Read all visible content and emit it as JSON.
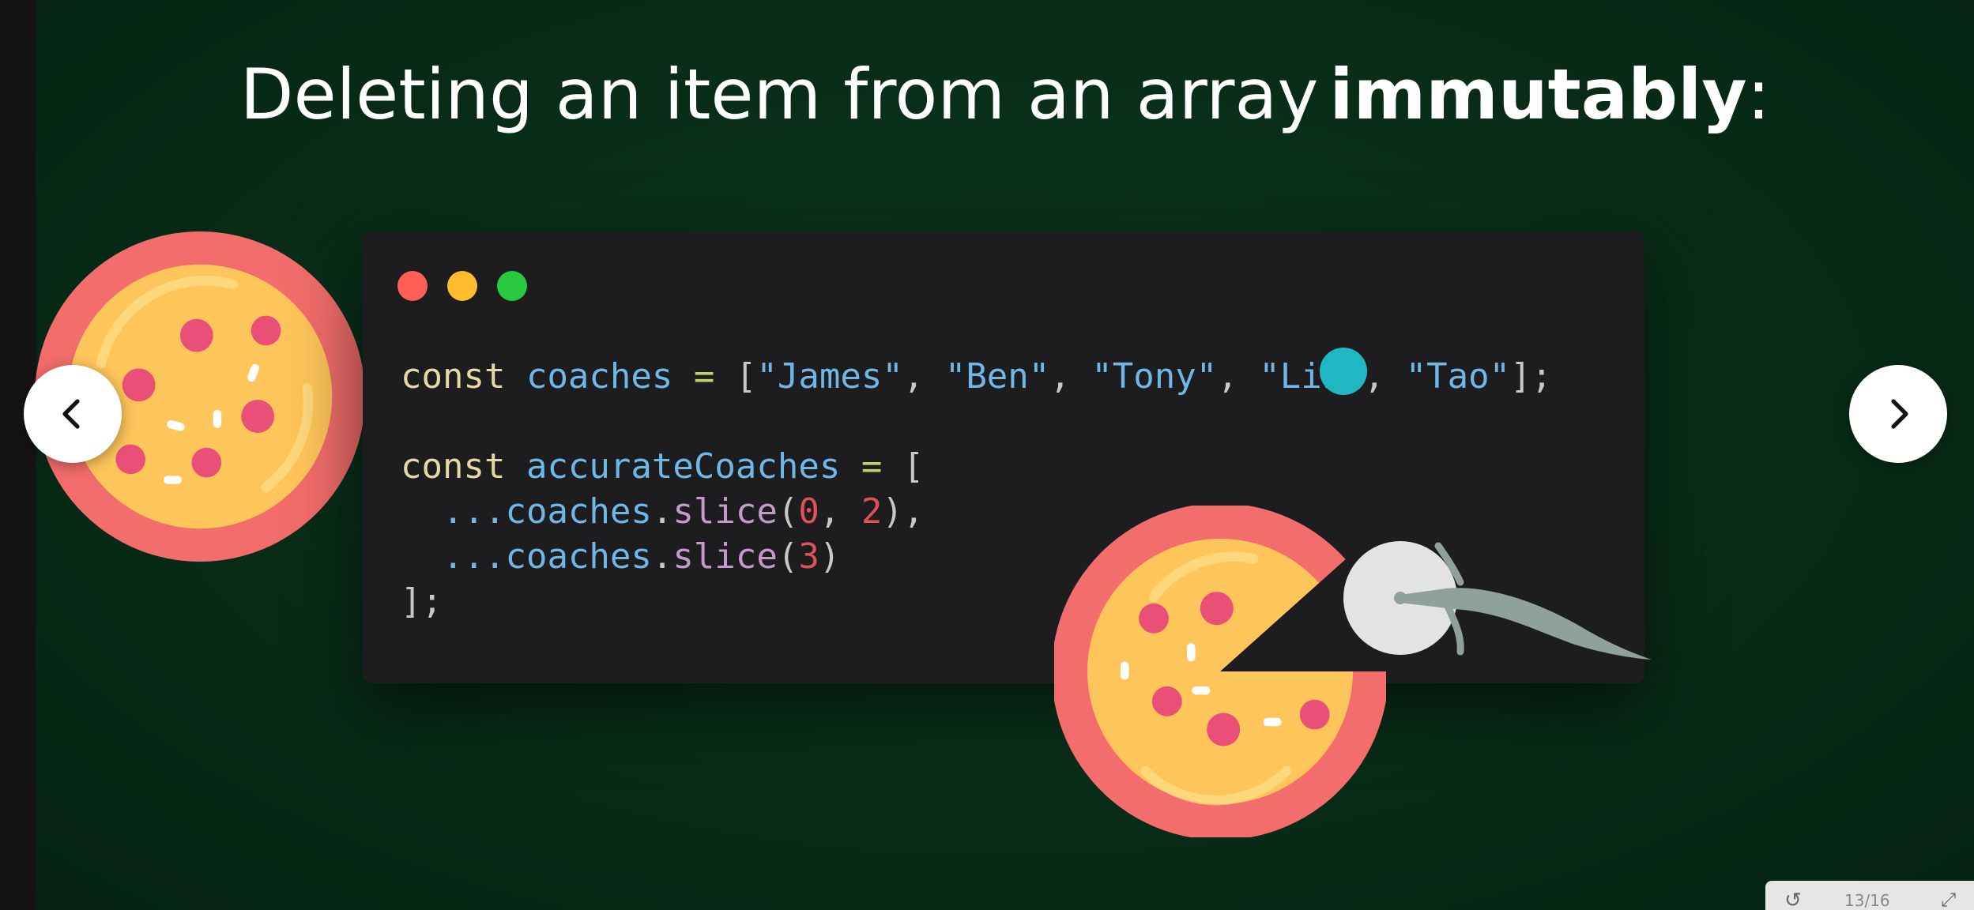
{
  "slide": {
    "title_normal": "Deleting  an item from an array",
    "title_bold": "immutably",
    "title_suffix": ":"
  },
  "code": {
    "line1": {
      "kw": "const",
      "name": "coaches",
      "op": "=",
      "open": "[",
      "s1": "\"James\"",
      "c1": ",",
      "s2": "\"Ben\"",
      "c2": ",",
      "s3": "\"Tony\"",
      "c3": ",",
      "s4": "\"Liz\"",
      "c4": ",",
      "s5": "\"Tao\"",
      "close": "];"
    },
    "line3": {
      "kw": "const",
      "name": "accurateCoaches",
      "op": "=",
      "open": "["
    },
    "line4": {
      "spread": "...",
      "obj": "coaches",
      "dot": ".",
      "fn": "slice",
      "po": "(",
      "a": "0",
      "comma": ",",
      "b": "2",
      "pc": "),"
    },
    "line5": {
      "spread": "...",
      "obj": "coaches",
      "dot": ".",
      "fn": "slice",
      "po": "(",
      "a": "3",
      "pc": ")"
    },
    "line6": {
      "close": "];"
    }
  },
  "nav": {
    "prev_icon": "chevron-left-icon",
    "next_icon": "chevron-right-icon"
  },
  "colors": {
    "background": "#042212",
    "code_bg": "#1d1d20",
    "traffic_red": "#ff5f57",
    "traffic_yellow": "#febc2e",
    "traffic_green": "#28c840",
    "cursor_highlight": "#1fb7c1",
    "pizza_crust": "#f26d6b",
    "pizza_cheese": "#fec55a",
    "pepperoni": "#ea4f77"
  },
  "toolbar": {
    "left_icon": "rotate-icon",
    "counter": "13/16",
    "right_icon": "expand-icon"
  }
}
